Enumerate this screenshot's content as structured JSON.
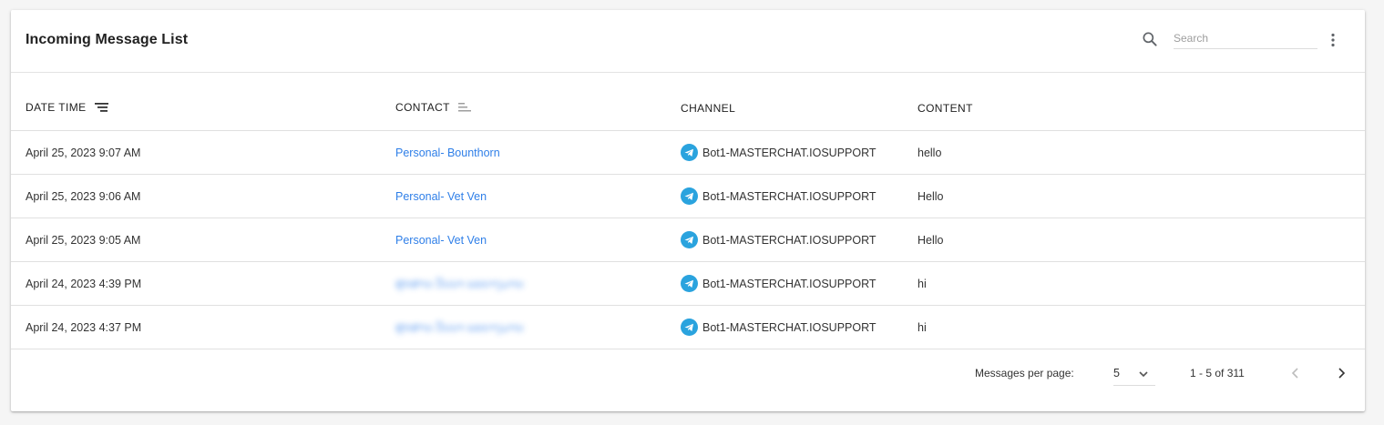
{
  "title": "Incoming Message List",
  "search": {
    "placeholder": "Search",
    "value": ""
  },
  "columns": {
    "date_time": "DATE TIME",
    "contact": "CONTACT",
    "channel": "CHANNEL",
    "content": "CONTENT"
  },
  "rows": [
    {
      "date_time": "April 25, 2023 9:07 AM",
      "contact": "Personal- Bounthorn",
      "contact_blurred": false,
      "channel": "Bot1-MASTERCHAT.IOSUPPORT",
      "content": "hello"
    },
    {
      "date_time": "April 25, 2023 9:06 AM",
      "contact": "Personal- Vet Ven",
      "contact_blurred": false,
      "channel": "Bot1-MASTERCHAT.IOSUPPORT",
      "content": "Hello"
    },
    {
      "date_time": "April 25, 2023 9:05 AM",
      "contact": "Personal- Vet Ven",
      "contact_blurred": false,
      "channel": "Bot1-MASTERCHAT.IOSUPPORT",
      "content": "Hello"
    },
    {
      "date_time": "April 24, 2023 4:39 PM",
      "contact": "",
      "contact_blurred": true,
      "channel": "Bot1-MASTERCHAT.IOSUPPORT",
      "content": "hi"
    },
    {
      "date_time": "April 24, 2023 4:37 PM",
      "contact": "",
      "contact_blurred": true,
      "channel": "Bot1-MASTERCHAT.IOSUPPORT",
      "content": "hi"
    }
  ],
  "pagination": {
    "per_page_label": "Messages per page:",
    "per_page_value": "5",
    "range_text": "1 - 5 of 311"
  },
  "icons": {
    "search": "search-icon",
    "menu": "more-vertical-icon",
    "sort_date": "sort-descending-icon",
    "sort_contact": "sort-icon",
    "channel": "telegram-icon",
    "dropdown": "chevron-down-icon",
    "prev": "chevron-left-icon",
    "next": "chevron-right-icon"
  },
  "colors": {
    "link": "#2f7fe8",
    "telegram": "#2aa3de",
    "divider": "#e0e0e0"
  }
}
